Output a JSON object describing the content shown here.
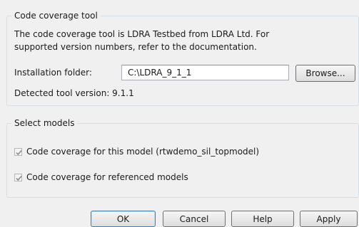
{
  "tool_group": {
    "title": "Code coverage tool",
    "description_line1": "The code coverage tool is LDRA Testbed from LDRA Ltd. For",
    "description_line2": "supported version numbers, refer to the documentation.",
    "install_label": "Installation folder:",
    "install_value": "C:\\LDRA_9_1_1",
    "browse_label": "Browse...",
    "detected_label": "Detected tool version: 9.1.1"
  },
  "models_group": {
    "title": "Select models",
    "options": [
      {
        "label": "Code coverage for this model (rtwdemo_sil_topmodel)",
        "checked": true
      },
      {
        "label": "Code coverage for referenced models",
        "checked": true
      }
    ]
  },
  "buttons": {
    "ok": "OK",
    "cancel": "Cancel",
    "help": "Help",
    "apply": "Apply"
  },
  "icons": {
    "checkmark": "checkmark-icon"
  },
  "colors": {
    "background": "#f0f0f0",
    "group_border": "#d5dfe5",
    "checkmark": "#8c8c8c",
    "default_button_border": "#3c7fb1"
  }
}
